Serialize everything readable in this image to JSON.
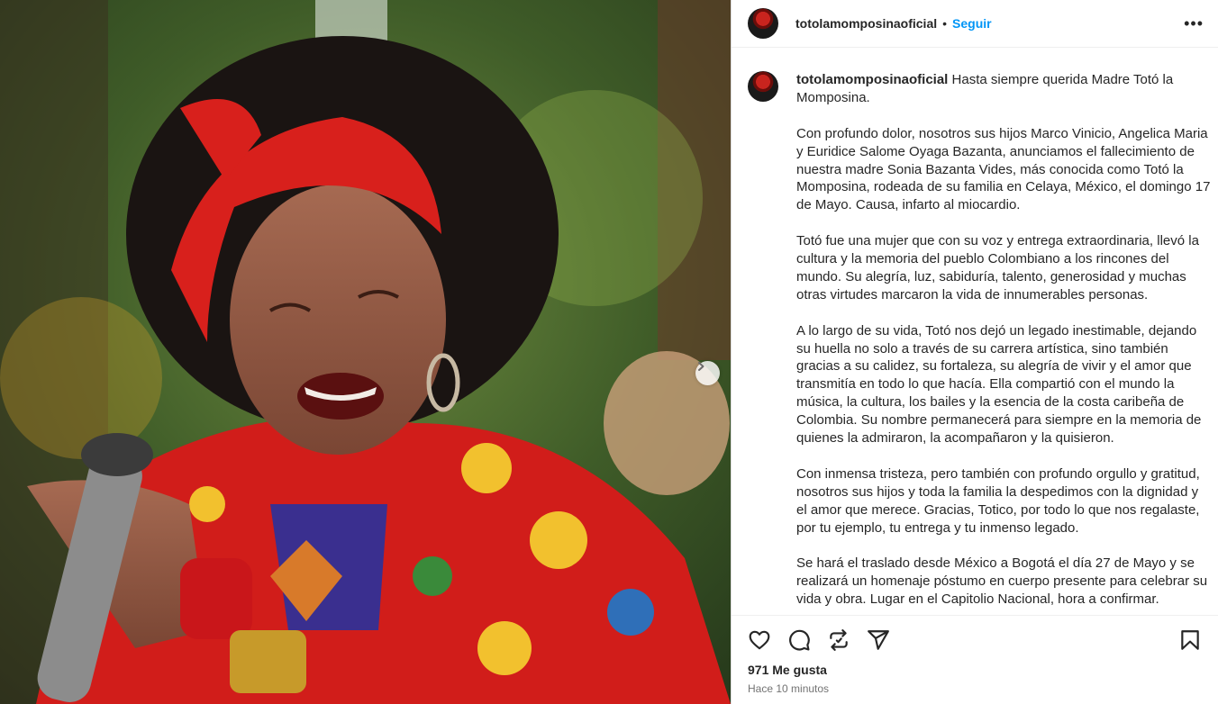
{
  "post": {
    "username": "totolamomposinaoficial",
    "follow_label": "Seguir",
    "separator": "•",
    "more_label": "•••",
    "caption": {
      "username": "totolamomposinaoficial",
      "paragraphs": [
        "Hasta siempre querida Madre Totó la Momposina.",
        "Con profundo dolor, nosotros sus hijos Marco Vinicio, Angelica Maria y Euridice Salome Oyaga Bazanta, anunciamos el fallecimiento de nuestra madre Sonia Bazanta Vides, más conocida como Totó la Momposina, rodeada de su familia en Celaya, México, el domingo 17 de Mayo. Causa, infarto al miocardio.",
        "Totó fue una mujer que con su voz y entrega extraordinaria, llevó la cultura y la memoria del pueblo Colombiano a los rincones del mundo. Su alegría, luz, sabiduría, talento, generosidad y muchas otras virtudes marcaron la vida de innumerables personas.",
        "A lo largo de su vida, Totó nos dejó un legado inestimable, dejando su huella no solo a través de su carrera artística, sino también gracias a su calidez, su fortaleza, su alegría de vivir y el amor que transmitía en todo lo que hacía. Ella compartió con el mundo la música, la cultura, los bailes y la esencia de la costa caribeña de Colombia. Su nombre permanecerá para siempre en la memoria de quienes la admiraron, la acompañaron y la quisieron.",
        "Con inmensa tristeza, pero también con profundo orgullo y gratitud, nosotros sus hijos y toda la familia la despedimos con la dignidad y el amor que merece. Gracias, Totico, por todo lo que nos regalaste, por tu ejemplo, tu entrega y tu inmenso legado.",
        "Se hará el traslado desde México a Bogotá el día 27 de Mayo y se realizará un homenaje póstumo en cuerpo presente para celebrar su vida y obra. Lugar en el Capitolio Nacional, hora a confirmar."
      ]
    },
    "likes": "971 Me gusta",
    "time": "Hace 10 minutos",
    "icons": {
      "like": "heart-icon",
      "comment": "comment-icon",
      "repost": "repost-icon",
      "share": "share-icon",
      "save": "bookmark-icon",
      "next": "chevron-right-icon"
    },
    "colors": {
      "accent": "#0095f6",
      "text": "#262626",
      "muted": "#737373"
    }
  }
}
